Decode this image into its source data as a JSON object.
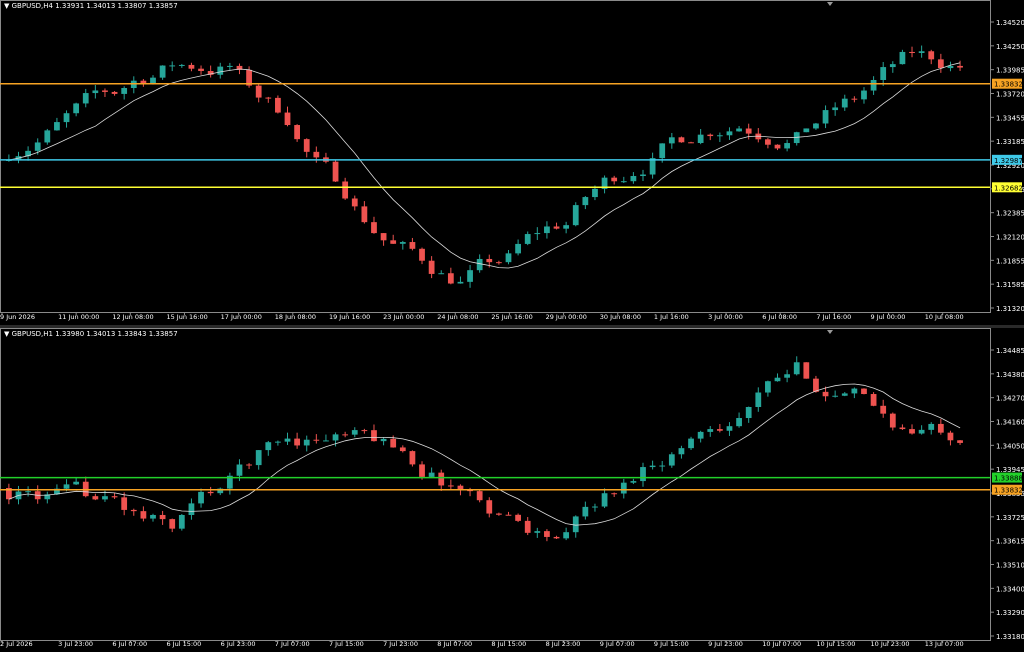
{
  "charts": [
    {
      "id": "h4",
      "symbol_line": "GBPUSD,H4  1.33931 1.34013 1.33807 1.33857",
      "ylim": [
        1.3132,
        1.3465
      ],
      "y_ticks": [
        "1.34520",
        "1.34250",
        "1.33985",
        "1.33720",
        "1.33455",
        "1.33185",
        "1.32920",
        "1.32655",
        "1.32385",
        "1.32120",
        "1.31855",
        "1.31585",
        "1.31320"
      ],
      "x_ticks": [
        "9 Jun 2026",
        "11 Jun 00:00",
        "12 Jun 08:00",
        "15 Jun 16:00",
        "17 Jun 00:00",
        "18 Jun 08:00",
        "19 Jun 16:00",
        "23 Jun 00:00",
        "24 Jun 08:00",
        "25 Jun 16:00",
        "29 Jun 00:00",
        "30 Jun 08:00",
        "1 Jul 16:00",
        "3 Jul 00:00",
        "6 Jul 08:00",
        "7 Jul 16:00",
        "9 Jul 00:00",
        "10 Jul 08:00"
      ],
      "h_lines": [
        {
          "value": 1.33832,
          "label": "1.33832",
          "color": "#f7a323",
          "text": "#000000"
        },
        {
          "value": 1.32987,
          "label": "1.32987",
          "color": "#3fc9e8",
          "text": "#000000"
        },
        {
          "value": 1.32682,
          "label": "1.32682",
          "color": "#ffff33",
          "text": "#000000"
        }
      ],
      "candles_seed": 7,
      "n_candles": 100
    },
    {
      "id": "h1",
      "symbol_line": "GBPUSD,H1  1.33980 1.34013 1.33843 1.33857",
      "ylim": [
        1.3315,
        1.3453
      ],
      "y_ticks": [
        "1.34485",
        "1.34380",
        "1.34270",
        "1.34160",
        "1.34050",
        "1.33945",
        "1.33835",
        "1.33725",
        "1.33615",
        "1.33510",
        "1.33400",
        "1.33290",
        "1.33180"
      ],
      "x_ticks": [
        "2 Jul 2026",
        "3 Jul 23:00",
        "6 Jul 07:00",
        "6 Jul 15:00",
        "6 Jul 23:00",
        "7 Jul 07:00",
        "7 Jul 15:00",
        "7 Jul 23:00",
        "8 Jul 07:00",
        "8 Jul 15:00",
        "8 Jul 23:00",
        "9 Jul 07:00",
        "9 Jul 15:00",
        "9 Jul 23:00",
        "10 Jul 07:00",
        "10 Jul 15:00",
        "10 Jul 23:00",
        "13 Jul 07:00"
      ],
      "h_lines": [
        {
          "value": 1.33888,
          "label": "1.33888",
          "color": "#22d12a",
          "text": "#000000"
        },
        {
          "value": 1.33832,
          "label": "1.33832",
          "color": "#f7a323",
          "text": "#000000"
        }
      ],
      "candles_seed": 13,
      "n_candles": 100
    }
  ],
  "colors": {
    "bull": "#26a69a",
    "bear": "#ef5350",
    "ma": "#dcdcdc",
    "axis_text": "#ffffff",
    "frame": "#8a8a8a"
  }
}
